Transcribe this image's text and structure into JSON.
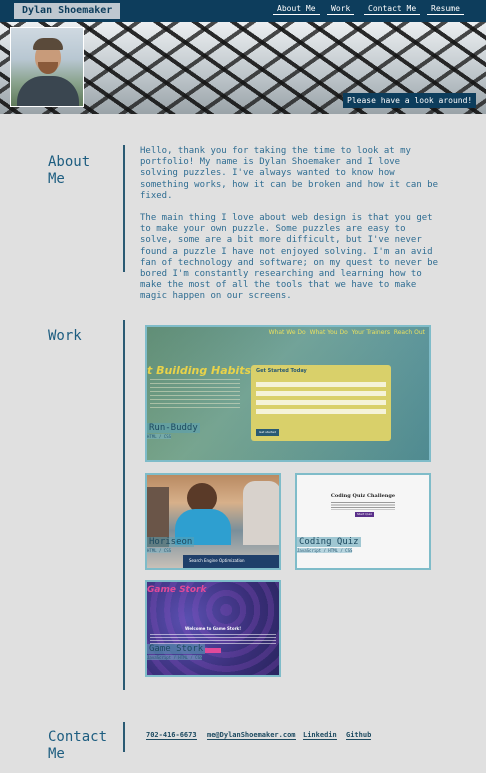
{
  "header": {
    "brand": "Dylan Shoemaker",
    "nav": [
      "About Me",
      "Work",
      "Contact Me",
      "Resume"
    ],
    "hero_tagline": "Please have a look around!"
  },
  "about": {
    "title": "About Me",
    "paragraphs": [
      "Hello, thank you for taking the time to look at my portfolio! My name is Dylan Shoemaker and I love solving puzzles. I've always wanted to know how something works, how it can be broken and how it can be fixed.",
      "The main thing I love about web design is that you get to make your own puzzle. Some puzzles are easy to solve, some are a bit more difficult, but I've never found a puzzle I have not enjoyed solving. I'm an avid fan of technology and software; on my quest to never be bored I'm constantly researching and learning how to make the most of all the tools that we have to make magic happen on our screens."
    ]
  },
  "work": {
    "title": "Work",
    "projects": [
      {
        "name": "Run-Buddy",
        "sub": "HTML / CSS",
        "screenshot": {
          "nav": [
            "What We Do",
            "What You Do",
            "Your Trainers",
            "Reach Out"
          ],
          "headline": "t Building Habits",
          "form_title": "Get Started Today",
          "button": "Get started"
        }
      },
      {
        "name": "Horiseon",
        "sub": "HTML / CSS",
        "screenshot": {
          "banner": "Search Engine Optimization"
        }
      },
      {
        "name": "Coding Quiz",
        "sub": "JavaScript / HTML / CSS",
        "screenshot": {
          "title": "Coding Quiz Challenge",
          "button": "Start Quiz"
        }
      },
      {
        "name": "Game Stork",
        "sub": "JavaScript / HTML / CSS",
        "screenshot": {
          "logo": "Game Stork",
          "welcome": "Welcome to Game Stork!"
        }
      }
    ]
  },
  "contact": {
    "title": "Contact Me",
    "links": [
      "702-416-6673",
      "me@DylanShoemaker.com",
      "Linkedin",
      "Github"
    ]
  },
  "colors": {
    "navy": "#0d3d5c",
    "teal_border": "#7fbcc9",
    "text_blue": "#2f6d92",
    "background": "#e0e0e0"
  }
}
